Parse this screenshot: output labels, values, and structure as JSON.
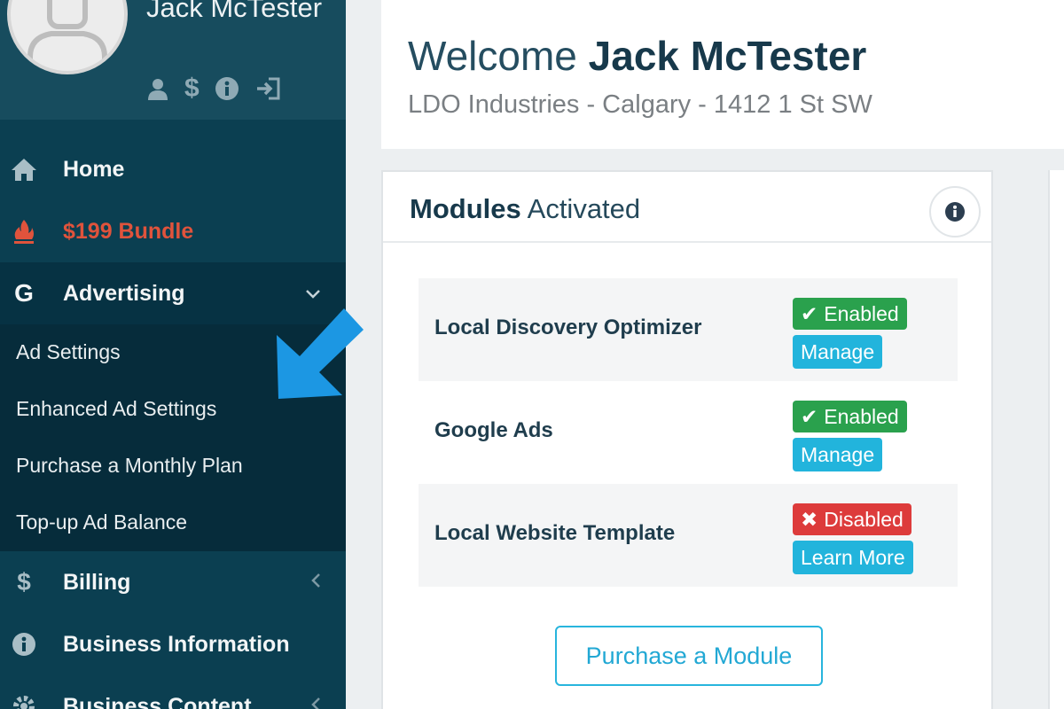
{
  "user": {
    "name": "Jack McTester",
    "icons": [
      "user-icon",
      "dollar-icon",
      "info-icon",
      "sign-out-icon"
    ]
  },
  "sidebar": {
    "items": [
      {
        "label": "Home",
        "icon": "home-icon"
      },
      {
        "label": "$199 Bundle",
        "icon": "fire-icon",
        "color": "#e0533c"
      },
      {
        "label": "Advertising",
        "icon": "google-icon",
        "expanded": true
      },
      {
        "label": "Billing",
        "icon": "dollar-icon"
      },
      {
        "label": "Business Information",
        "icon": "info-icon"
      },
      {
        "label": "Business Content",
        "icon": "gear-icon"
      }
    ],
    "sub_items": [
      {
        "label": "Ad Settings"
      },
      {
        "label": "Enhanced Ad Settings"
      },
      {
        "label": "Purchase a Monthly Plan"
      },
      {
        "label": "Top-up Ad Balance"
      }
    ]
  },
  "welcome": {
    "prefix": "Welcome",
    "name": "Jack McTester",
    "subtitle": "LDO Industries - Calgary - 1412 1 St SW"
  },
  "modules_panel": {
    "title_bold": "Modules",
    "title_rest": "Activated",
    "modules": [
      {
        "name": "Local Discovery Optimizer",
        "status": "Enabled",
        "action": "Manage"
      },
      {
        "name": "Google Ads",
        "status": "Enabled",
        "action": "Manage"
      },
      {
        "name": "Local Website Template",
        "status": "Disabled",
        "action": "Learn More"
      }
    ],
    "purchase_label": "Purchase a Module"
  },
  "colors": {
    "sidebar_bg": "#0b3f51",
    "enabled": "#2aa14d",
    "disabled": "#dd3b3b",
    "action": "#22b4dc",
    "annotation_arrow": "#1c97e3"
  }
}
